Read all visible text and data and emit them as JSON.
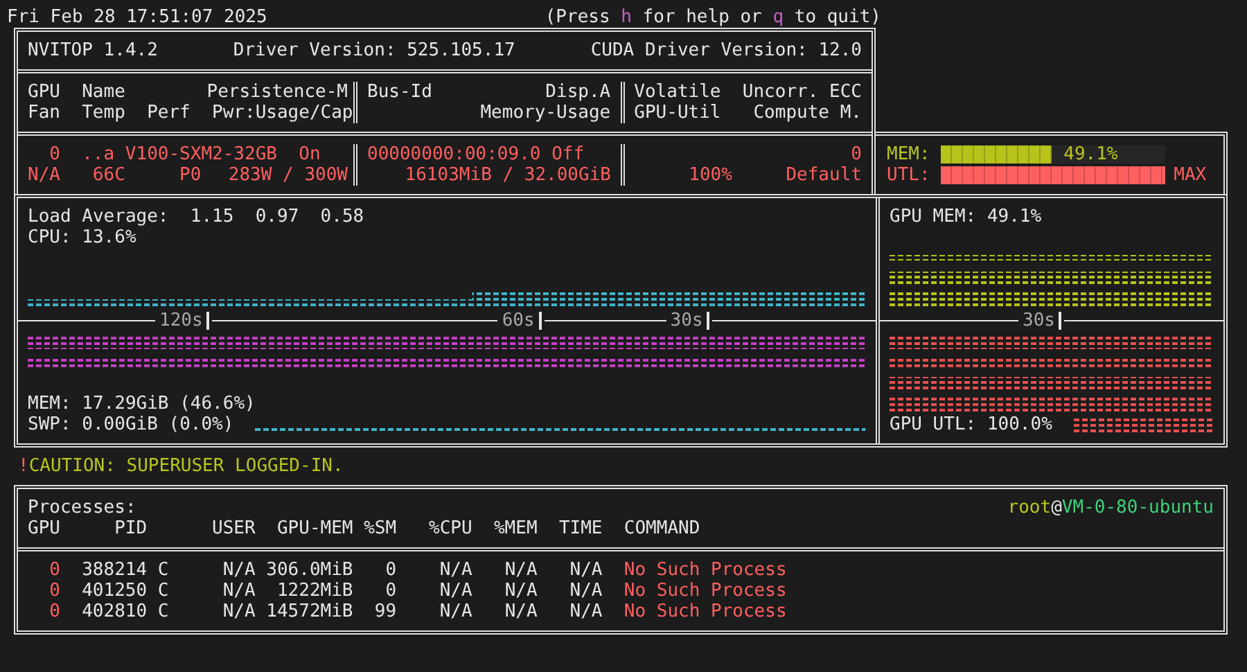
{
  "header": {
    "datetime": "Fri Feb 28 17:51:07 2025",
    "help": [
      {
        "text": "(Press ",
        "kind": "plain"
      },
      {
        "text": "h",
        "kind": "key"
      },
      {
        "text": " for help or ",
        "kind": "plain"
      },
      {
        "text": "q",
        "kind": "key"
      },
      {
        "text": " to quit)",
        "kind": "plain"
      }
    ]
  },
  "gpu_table": {
    "title": "NVITOP 1.4.2",
    "driver_version": "Driver Version: 525.105.17",
    "cuda_version": "CUDA Driver Version: 12.0",
    "headers": {
      "gpu": "GPU",
      "name": "Name",
      "persistence": "Persistence-M",
      "fan": "Fan",
      "temp": "Temp",
      "perf": "Perf",
      "power": "Pwr:Usage/Cap",
      "bus_id": "Bus-Id",
      "disp": "Disp.A",
      "memory_usage": "Memory-Usage",
      "volatile": "Volatile",
      "ecc": "Uncorr. ECC",
      "gpu_util": "GPU-Util",
      "compute": "Compute M."
    },
    "gpus": [
      {
        "index": "0",
        "name": "..a V100-SXM2-32GB",
        "persistence": "On",
        "fan": "N/A",
        "temp": "66C",
        "perf": "P0",
        "power": "283W / 300W",
        "bus_id": "00000000:00:09.0",
        "disp": "Off",
        "memory": "16103MiB / 32.00GiB",
        "ecc": "0",
        "gpu_util": "100%",
        "compute": "Default",
        "mem_bar": {
          "label": "MEM:",
          "level": 0.491,
          "reading": "49.1%"
        },
        "util_bar": {
          "label": "UTL:",
          "level": 1.0,
          "reading": "MAX"
        }
      }
    ]
  },
  "host_panel": {
    "load_average": "Load Average:",
    "loads": [
      "1.15",
      "0.97",
      "0.58"
    ],
    "cpu": "CPU: 13.6%",
    "time_labels": [
      "120s",
      "60s",
      "30s"
    ],
    "mem": "MEM: 17.29GiB (46.6%)",
    "swap": "SWP: 0.00GiB (0.0%)"
  },
  "gpu_panel": {
    "gpu_mem": "GPU MEM: 49.1%",
    "time_label": "30s",
    "gpu_util": "GPU UTL: 100.0%"
  },
  "caution": {
    "mark": "!",
    "text": "CAUTION: SUPERUSER LOGGED-IN."
  },
  "processes": {
    "title": "Processes:",
    "user": "root",
    "separator": "@",
    "host": "VM-0-80-ubuntu",
    "columns": [
      "GPU",
      "PID",
      "USER",
      "GPU-MEM",
      "%SM",
      "%CPU",
      "%MEM",
      "TIME",
      "COMMAND"
    ],
    "rows": [
      {
        "cells": [
          "0",
          "388214 C",
          "N/A",
          "306.0MiB",
          "0",
          "N/A",
          "N/A",
          "N/A",
          "No Such Process"
        ]
      },
      {
        "cells": [
          "0",
          "401250 C",
          "N/A",
          "1222MiB",
          "0",
          "N/A",
          "N/A",
          "N/A",
          "No Such Process"
        ]
      },
      {
        "cells": [
          "0",
          "402810 C",
          "N/A",
          "14572MiB",
          "99",
          "N/A",
          "N/A",
          "N/A",
          "No Such Process"
        ]
      }
    ]
  }
}
